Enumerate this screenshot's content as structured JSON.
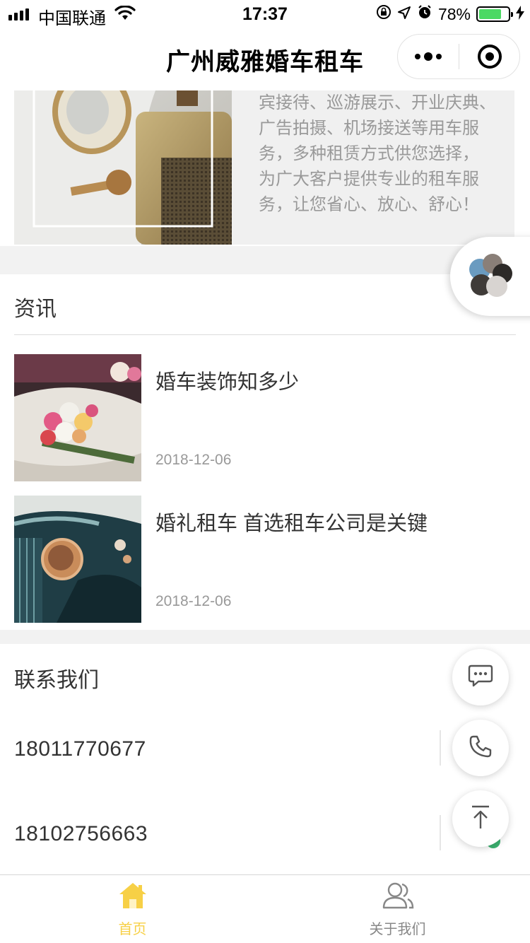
{
  "status_bar": {
    "carrier": "中国联通",
    "time": "17:37",
    "battery": "78%",
    "battery_level": 0.78,
    "battery_color": "#4cd964"
  },
  "nav": {
    "title": "广州威雅婚车租车",
    "more_icon": "more-dots-icon",
    "close_icon": "target-circle-icon"
  },
  "intro": {
    "lines": [
      "宾接待、巡游展示、开业庆典、",
      "广告拍摄、机场接送等用车服",
      "务，多种租赁方式供您选择，",
      "为广大客户提供专业的租车服",
      "务，让您省心、放心、舒心！"
    ]
  },
  "news": {
    "title": "资讯",
    "items": [
      {
        "title": "婚车装饰知多少",
        "date": "2018-12-06"
      },
      {
        "title": "婚礼租车 首选租车公司是关键",
        "date": "2018-12-06"
      }
    ]
  },
  "contact": {
    "title": "联系我们",
    "phones": [
      "18011770677",
      "18102756663"
    ]
  },
  "tabbar": {
    "active_color": "#f7d046",
    "inactive_color": "#888888",
    "tabs": [
      {
        "label": "首页",
        "icon": "home-icon",
        "active": true
      },
      {
        "label": "关于我们",
        "icon": "users-icon",
        "active": false
      }
    ]
  },
  "floating": {
    "brand_icon": "flower-logo-icon",
    "chat_icon": "chat-bubble-icon",
    "phone_icon": "phone-icon",
    "top_icon": "back-to-top-icon"
  }
}
